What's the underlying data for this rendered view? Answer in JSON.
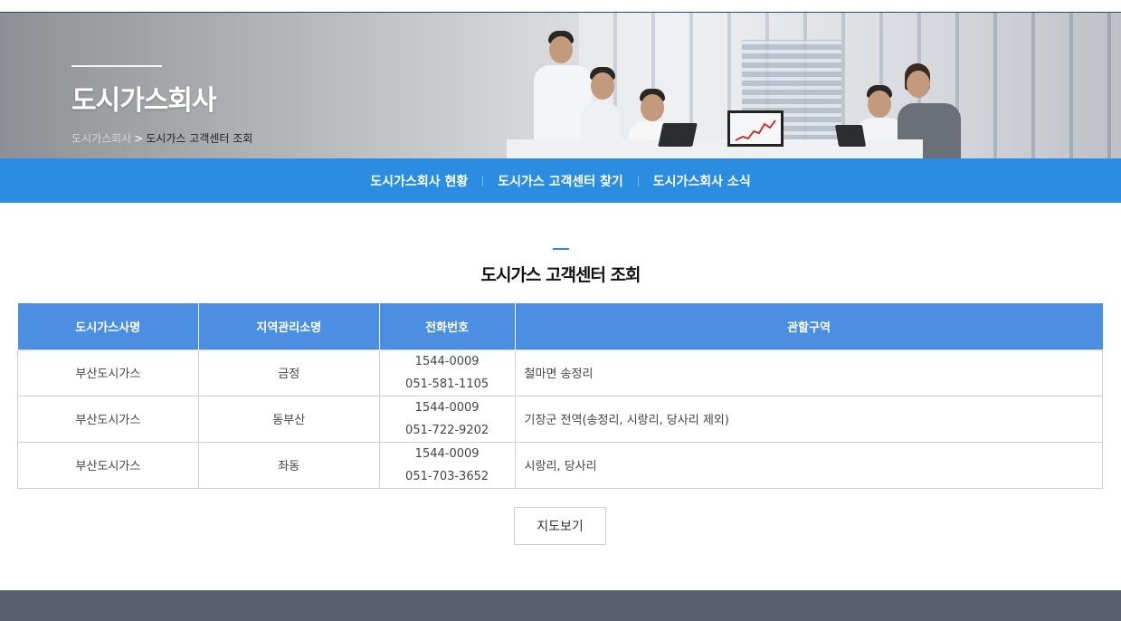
{
  "hero": {
    "title": "도시가스회사",
    "breadcrumb": {
      "parent": "도시가스회사",
      "separator": ">",
      "current": "도시가스 고객센터 조회"
    }
  },
  "subnav": {
    "items": [
      {
        "label": "도시가스회사 현황"
      },
      {
        "label": "도시가스 고객센터 찾기"
      },
      {
        "label": "도시가스회사 소식"
      }
    ]
  },
  "section": {
    "title": "도시가스 고객센터 조회"
  },
  "table": {
    "headers": [
      "도시가스사명",
      "지역관리소명",
      "전화번호",
      "관할구역"
    ],
    "rows": [
      {
        "company": "부산도시가스",
        "office": "금정",
        "phone1": "1544-0009",
        "phone2": "051-581-1105",
        "area": "철마면 송정리"
      },
      {
        "company": "부산도시가스",
        "office": "동부산",
        "phone1": "1544-0009",
        "phone2": "051-722-9202",
        "area": "기장군 전역(송정리, 시랑리, 당사리 제외)"
      },
      {
        "company": "부산도시가스",
        "office": "좌동",
        "phone1": "1544-0009",
        "phone2": "051-703-3652",
        "area": "시랑리, 당사리"
      }
    ]
  },
  "map_button": {
    "label": "지도보기"
  },
  "colors": {
    "accent": "#2a8de2",
    "header_bg": "#4a8fe2",
    "footer": "#5a5e6e"
  }
}
